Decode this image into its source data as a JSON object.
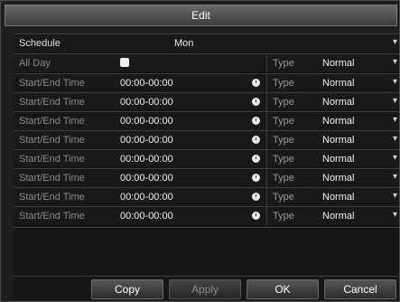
{
  "dialog": {
    "title": "Edit"
  },
  "schedule": {
    "label": "Schedule",
    "day": "Mon"
  },
  "allday": {
    "label": "All Day",
    "checked": true,
    "type_label": "Type",
    "type_value": "Normal"
  },
  "rows": [
    {
      "label": "Start/End Time",
      "time": "00:00-00:00",
      "type_label": "Type",
      "type_value": "Normal"
    },
    {
      "label": "Start/End Time",
      "time": "00:00-00:00",
      "type_label": "Type",
      "type_value": "Normal"
    },
    {
      "label": "Start/End Time",
      "time": "00:00-00:00",
      "type_label": "Type",
      "type_value": "Normal"
    },
    {
      "label": "Start/End Time",
      "time": "00:00-00:00",
      "type_label": "Type",
      "type_value": "Normal"
    },
    {
      "label": "Start/End Time",
      "time": "00:00-00:00",
      "type_label": "Type",
      "type_value": "Normal"
    },
    {
      "label": "Start/End Time",
      "time": "00:00-00:00",
      "type_label": "Type",
      "type_value": "Normal"
    },
    {
      "label": "Start/End Time",
      "time": "00:00-00:00",
      "type_label": "Type",
      "type_value": "Normal"
    },
    {
      "label": "Start/End Time",
      "time": "00:00-00:00",
      "type_label": "Type",
      "type_value": "Normal"
    }
  ],
  "buttons": {
    "copy": "Copy",
    "apply": "Apply",
    "ok": "OK",
    "cancel": "Cancel"
  },
  "icons": {
    "clock": "clock-icon",
    "dropdown": "chevron-down-icon",
    "checkbox": "checkbox-icon"
  }
}
